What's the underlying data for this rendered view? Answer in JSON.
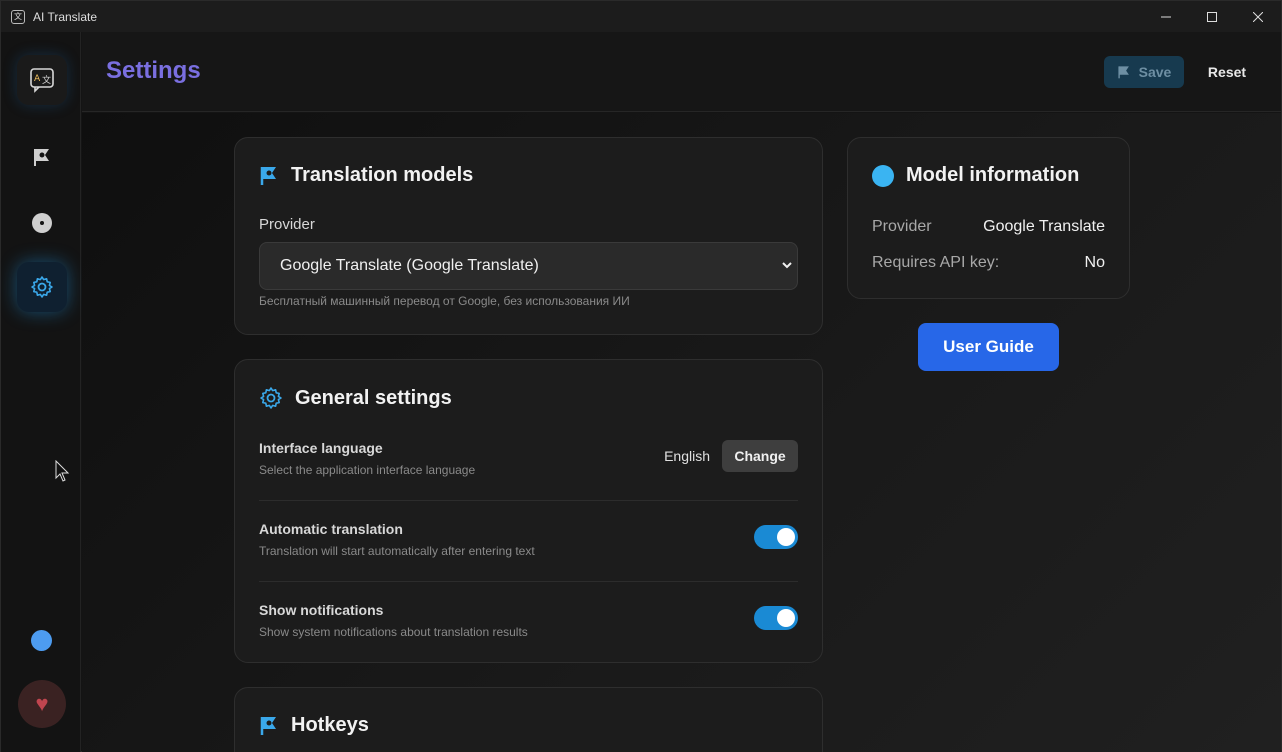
{
  "window": {
    "title": "AI Translate",
    "app_icon_glyph": "文"
  },
  "header": {
    "title": "Settings",
    "save_label": "Save",
    "reset_label": "Reset"
  },
  "sidebar": {
    "items": [
      {
        "name": "translate-icon"
      },
      {
        "name": "flag-icon"
      },
      {
        "name": "history-icon"
      },
      {
        "name": "settings-icon",
        "active": true
      }
    ]
  },
  "translation_models": {
    "title": "Translation models",
    "provider_label": "Provider",
    "provider_value": "Google Translate (Google Translate)",
    "provider_hint": "Бесплатный машинный перевод от Google, без использования ИИ"
  },
  "general_settings": {
    "title": "General settings",
    "interface_language": {
      "label": "Interface language",
      "hint": "Select the application interface language",
      "value": "English",
      "button": "Change"
    },
    "auto_translation": {
      "label": "Automatic translation",
      "hint": "Translation will start automatically after entering text",
      "enabled": true
    },
    "notifications": {
      "label": "Show notifications",
      "hint": "Show system notifications about translation results",
      "enabled": true
    }
  },
  "hotkeys": {
    "title": "Hotkeys"
  },
  "model_info": {
    "title": "Model information",
    "provider_key": "Provider",
    "provider_value": "Google Translate",
    "api_key_key": "Requires API key:",
    "api_key_value": "No"
  },
  "user_guide_label": "User Guide",
  "colors": {
    "accent": "#1a8ad4",
    "title": "#7a6fe0",
    "primary_button": "#2767e8"
  }
}
